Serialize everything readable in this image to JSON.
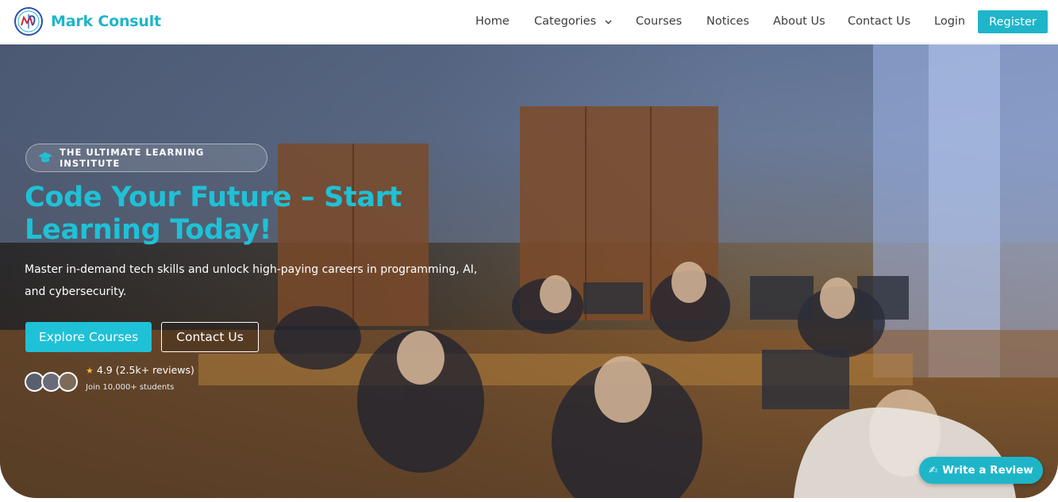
{
  "brand": {
    "name": "Mark Consult",
    "logo_icon": "mc-logo-icon"
  },
  "nav": {
    "items": [
      {
        "label": "Home"
      },
      {
        "label": "Categories",
        "icon": "chevron-down-icon"
      },
      {
        "label": "Courses"
      },
      {
        "label": "Notices"
      },
      {
        "label": "About Us"
      },
      {
        "label": "Contact Us"
      },
      {
        "label": "Login"
      }
    ],
    "register_label": "Register"
  },
  "hero": {
    "badge": {
      "icon": "graduation-cap-icon",
      "text": "THE ULTIMATE LEARNING INSTITUTE"
    },
    "title": "Code Your Future – Start Learning Today!",
    "subtitle": "Master in-demand tech skills and unlock high-paying careers in programming, AI, and cybersecurity.",
    "buttons": {
      "explore": "Explore Courses",
      "contact": "Contact Us"
    },
    "rating": {
      "text": "4.9 (2.5k+ reviews)",
      "star_icon": "star-icon"
    },
    "join_text": "Join 10,000+ students"
  },
  "review_button": {
    "label": "Write a Review",
    "icon": "pen-icon"
  },
  "colors": {
    "accent": "#1fb5c9",
    "title": "#1fc1d6",
    "star": "#f5b82e"
  }
}
